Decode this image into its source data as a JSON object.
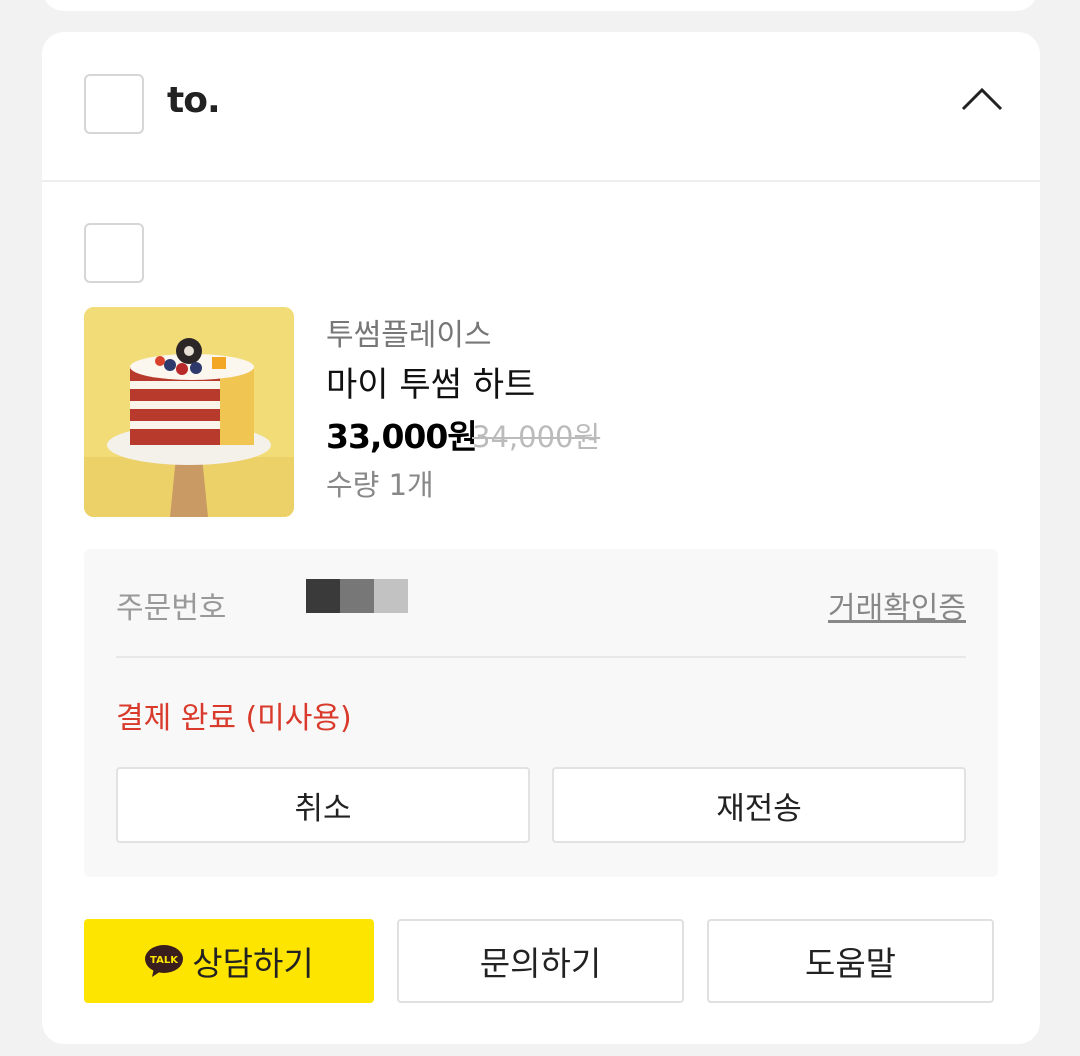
{
  "header": {
    "recipient": "to."
  },
  "product": {
    "shop": "투썸플레이스",
    "name": "마이 투썸 하트",
    "price": "33,000원",
    "original_price": "34,000원",
    "quantity": "수량 1개"
  },
  "order": {
    "number_label": "주문번호",
    "receipt_link": "거래확인증",
    "status": "결제 완료 (미사용)",
    "status_color": "#d93a2b",
    "cancel_label": "취소",
    "resend_label": "재전송"
  },
  "actions": {
    "consult_label": "상담하기",
    "consult_icon_text": "TALK",
    "inquiry_label": "문의하기",
    "help_label": "도움말",
    "kakao_color": "#fee500"
  }
}
